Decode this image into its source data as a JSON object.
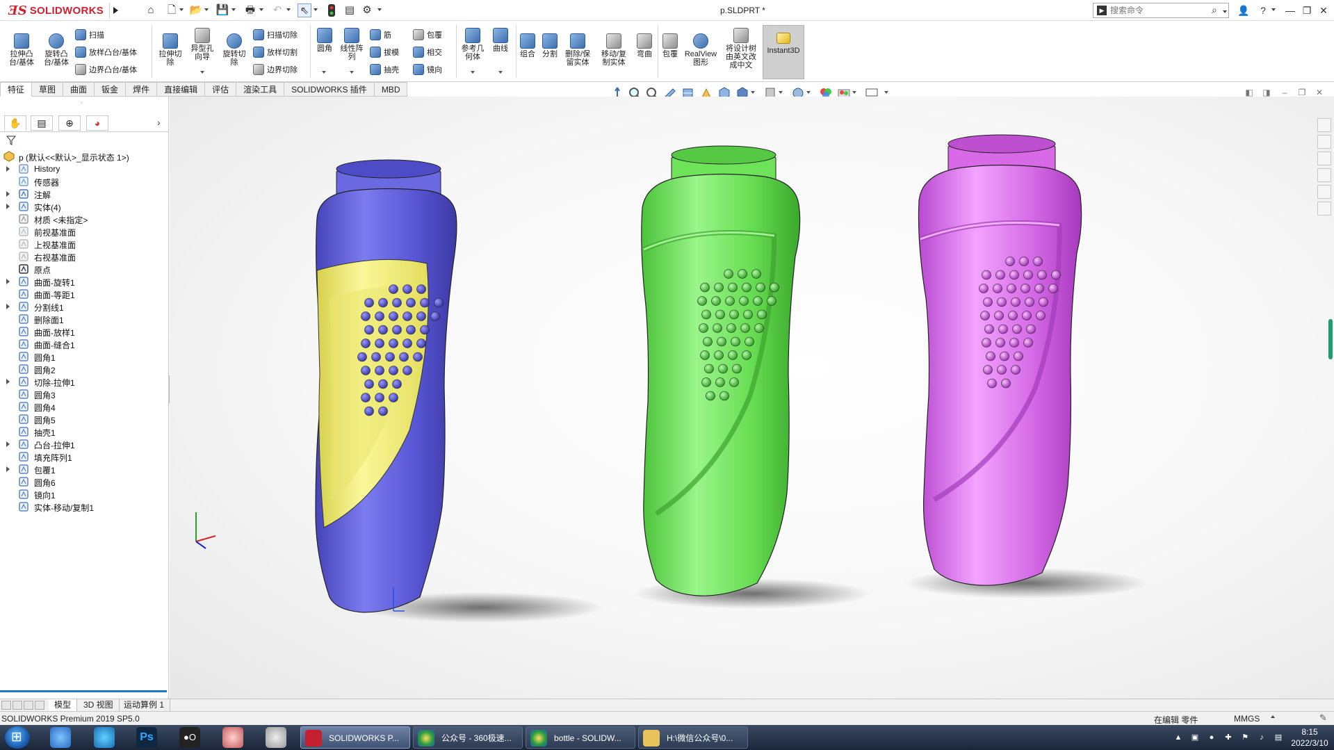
{
  "app": {
    "brand": "SOLIDWORKS",
    "document_title": "p.SLDPRT *",
    "search_placeholder": "搜索命令"
  },
  "ribbon": {
    "extrude_boss": "拉伸凸\n台/基体",
    "revolve_boss": "旋转凸\n台/基体",
    "sweep": "扫描",
    "loft_boss": "放样凸台/基体",
    "boundary_boss": "边界凸台/基体",
    "extrude_cut": "拉伸切\n除",
    "hole_wizard": "异型孔\n向导",
    "revolve_cut": "旋转切\n除",
    "swept_cut": "扫描切除",
    "lofted_cut": "放样切割",
    "boundary_cut": "边界切除",
    "fillet": "圆角",
    "linear_pattern": "线性阵\n列",
    "rib": "筋",
    "draft": "拔模",
    "shell": "抽壳",
    "wrap": "包覆",
    "intersect": "相交",
    "mirror": "镜向",
    "ref_geometry": "参考几\n何体",
    "curves": "曲线",
    "combine": "组合",
    "split": "分割",
    "delete_keep_body": "删除/保\n留实体",
    "move_copy_body": "移动/复\n制实体",
    "flex": "弯曲",
    "wrap2": "包覆",
    "realview": "RealView\n图形",
    "translate_tree": "将设计树\n由英文改\n成中文",
    "instant3d": "Instant3D"
  },
  "command_tabs": [
    "特征",
    "草图",
    "曲面",
    "钣金",
    "焊件",
    "直接编辑",
    "评估",
    "渲染工具",
    "SOLIDWORKS 插件",
    "MBD"
  ],
  "tree": {
    "root": "p (默认<<默认>_显示状态 1>)",
    "items": [
      {
        "label": "History",
        "expand": true,
        "icon": "history-icon"
      },
      {
        "label": "传感器",
        "expand": false,
        "icon": "sensor-icon"
      },
      {
        "label": "注解",
        "expand": true,
        "icon": "annotation-icon"
      },
      {
        "label": "实体(4)",
        "expand": true,
        "icon": "solid-bodies-icon"
      },
      {
        "label": "材质 <未指定>",
        "expand": false,
        "icon": "material-icon"
      },
      {
        "label": "前视基准面",
        "expand": false,
        "icon": "plane-icon"
      },
      {
        "label": "上视基准面",
        "expand": false,
        "icon": "plane-icon"
      },
      {
        "label": "右视基准面",
        "expand": false,
        "icon": "plane-icon"
      },
      {
        "label": "原点",
        "expand": false,
        "icon": "origin-icon"
      },
      {
        "label": "曲面-旋转1",
        "expand": true,
        "icon": "surface-revolve-icon"
      },
      {
        "label": "曲面-等距1",
        "expand": false,
        "icon": "surface-offset-icon"
      },
      {
        "label": "分割线1",
        "expand": true,
        "icon": "split-line-icon"
      },
      {
        "label": "删除面1",
        "expand": false,
        "icon": "delete-face-icon"
      },
      {
        "label": "曲面-放样1",
        "expand": false,
        "icon": "surface-loft-icon"
      },
      {
        "label": "曲面-缝合1",
        "expand": false,
        "icon": "surface-knit-icon"
      },
      {
        "label": "圆角1",
        "expand": false,
        "icon": "fillet-icon"
      },
      {
        "label": "圆角2",
        "expand": false,
        "icon": "fillet-icon"
      },
      {
        "label": "切除-拉伸1",
        "expand": true,
        "icon": "cut-extrude-icon"
      },
      {
        "label": "圆角3",
        "expand": false,
        "icon": "fillet-icon"
      },
      {
        "label": "圆角4",
        "expand": false,
        "icon": "fillet-icon"
      },
      {
        "label": "圆角5",
        "expand": false,
        "icon": "fillet-icon"
      },
      {
        "label": "抽壳1",
        "expand": false,
        "icon": "shell-icon"
      },
      {
        "label": "凸台-拉伸1",
        "expand": true,
        "icon": "boss-extrude-icon"
      },
      {
        "label": "填充阵列1",
        "expand": false,
        "icon": "fill-pattern-icon"
      },
      {
        "label": "包覆1",
        "expand": true,
        "icon": "wrap-icon"
      },
      {
        "label": "圆角6",
        "expand": false,
        "icon": "fillet-icon"
      },
      {
        "label": "镜向1",
        "expand": false,
        "icon": "mirror-icon"
      },
      {
        "label": "实体-移动/复制1",
        "expand": false,
        "icon": "move-copy-icon"
      }
    ]
  },
  "model_tabs": [
    "模型",
    "3D 视图",
    "运动算例 1"
  ],
  "status": {
    "product": "SOLIDWORKS Premium 2019 SP5.0",
    "editing": "在编辑 零件",
    "units": "MMGS"
  },
  "taskbar": {
    "tasks": [
      "SOLIDWORKS P...",
      "公众号 - 360极速...",
      "bottle - SOLIDW...",
      "H:\\微信公众号\\0..."
    ],
    "time": "8:15",
    "date": "2022/3/10"
  },
  "colors": {
    "bottle_blue": "#5a58d6",
    "label_yellow": "#efec7a",
    "bottle_green": "#6ee35a",
    "bottle_magenta": "#d86ae8",
    "brand_red": "#d11f2f"
  }
}
